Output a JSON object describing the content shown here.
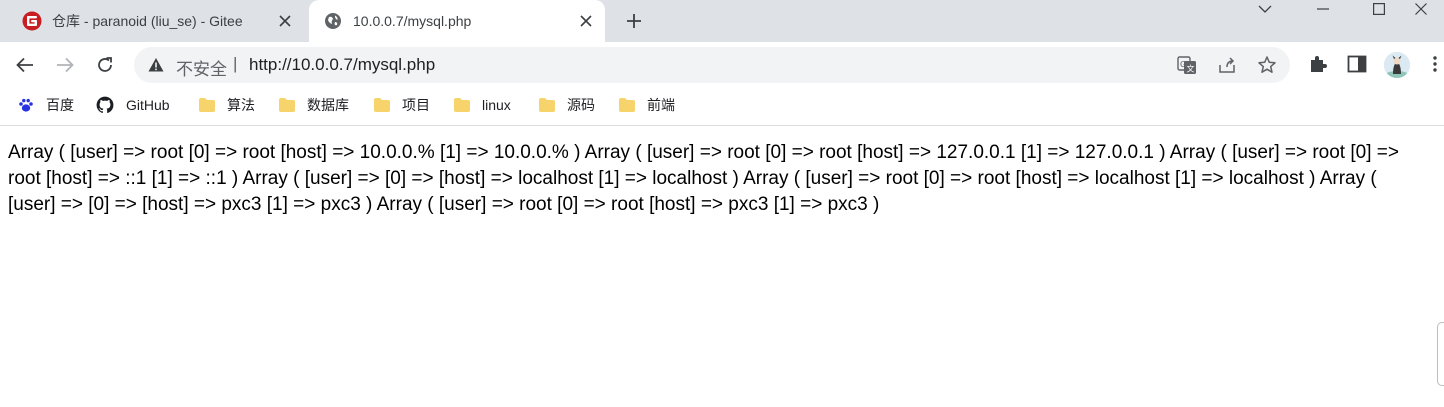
{
  "tabs": [
    {
      "title": "仓库 - paranoid (liu_se) - Gitee",
      "favicon": "gitee-icon",
      "active": false
    },
    {
      "title": "10.0.0.7/mysql.php",
      "favicon": "globe-icon",
      "active": true
    }
  ],
  "address_bar": {
    "security_label": "不安全",
    "separator": "|",
    "url": "http://10.0.0.7/mysql.php"
  },
  "bookmarks": [
    {
      "label": "百度",
      "icon": "baidu-paw-icon"
    },
    {
      "label": "GitHub",
      "icon": "github-icon"
    },
    {
      "label": "算法",
      "icon": "folder-icon"
    },
    {
      "label": "数据库",
      "icon": "folder-icon"
    },
    {
      "label": "项目",
      "icon": "folder-icon"
    },
    {
      "label": "linux",
      "icon": "folder-icon"
    },
    {
      "label": "源码",
      "icon": "folder-icon"
    },
    {
      "label": "前端",
      "icon": "folder-icon"
    }
  ],
  "page": {
    "output": "Array ( [user] => root [0] => root [host] => 10.0.0.% [1] => 10.0.0.% ) Array ( [user] => root [0] => root [host] => 127.0.0.1 [1] => 127.0.0.1 ) Array ( [user] => root [0] => root [host] => ::1 [1] => ::1 ) Array ( [user] => [0] => [host] => localhost [1] => localhost ) Array ( [user] => root [0] => root [host] => localhost [1] => localhost ) Array ( [user] => [0] => [host] => pxc3 [1] => pxc3 ) Array ( [user] => root [0] => root [host] => pxc3 [1] => pxc3 )"
  },
  "colors": {
    "tabstrip": "#dee1e6",
    "omnibox": "#f1f3f4",
    "folder": "#f6d36b",
    "gitee_red": "#c71d23"
  }
}
